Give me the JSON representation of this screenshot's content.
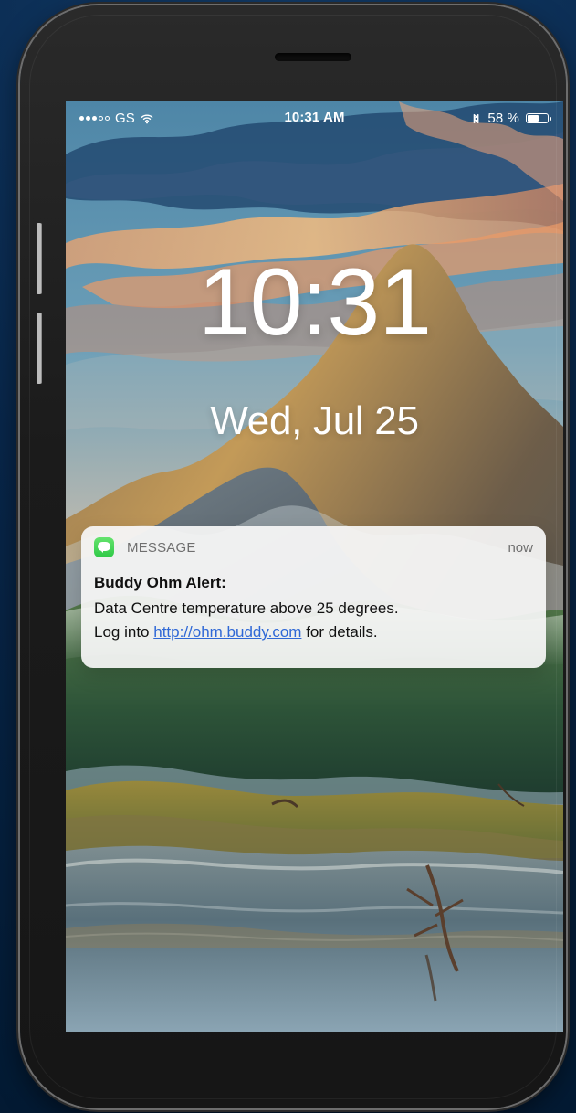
{
  "status_bar": {
    "carrier": "GS",
    "time": "10:31 AM",
    "battery": "58 %",
    "battery_level": 0.58
  },
  "lock_screen": {
    "time": "10:31",
    "date": "Wed, Jul 25"
  },
  "notification": {
    "app_name": "MESSAGE",
    "time": "now",
    "title": "Buddy Ohm Alert:",
    "line1": "Data Centre temperature above 25 degrees.",
    "line2_prefix": "Log into",
    "link_text": "http://ohm.buddy.com",
    "line2_suffix": "for details."
  }
}
